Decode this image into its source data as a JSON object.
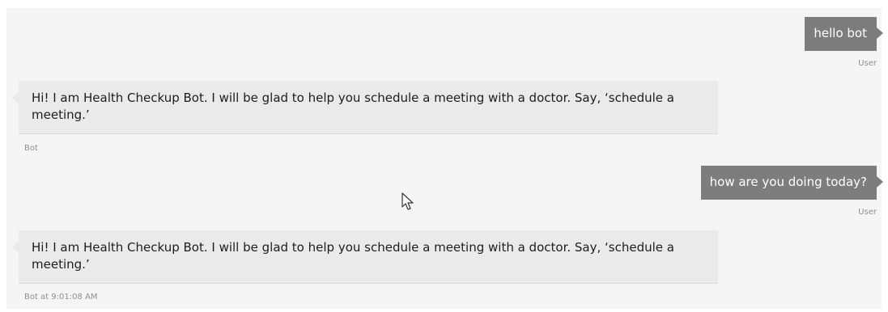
{
  "conversation": {
    "messages": [
      {
        "sender": "user",
        "text": "hello bot",
        "meta": "User"
      },
      {
        "sender": "bot",
        "text": "Hi! I am Health Checkup Bot. I will be glad to help you schedule a meeting with a doctor. Say, ‘schedule a meeting.’",
        "meta": "Bot"
      },
      {
        "sender": "user",
        "text": "how are you doing today?",
        "meta": "User"
      },
      {
        "sender": "bot",
        "text": "Hi! I am Health Checkup Bot. I will be glad to help you schedule a meeting with a doctor. Say, ‘schedule a meeting.’",
        "meta": "Bot at 9:01:08 AM"
      }
    ]
  },
  "colors": {
    "user_bubble": "#7d7d7d",
    "bot_bubble": "#eaeaea",
    "panel_background": "#f5f5f5",
    "meta_text": "#8e8e8e"
  },
  "icons": {
    "cursor": "mouse-pointer-icon"
  }
}
